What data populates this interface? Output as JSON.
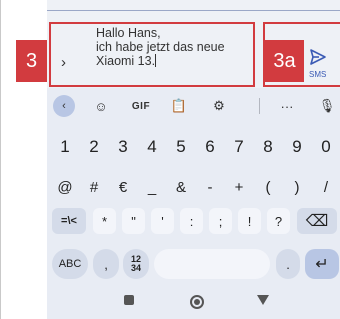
{
  "callouts": {
    "compose": "3",
    "send": "3a"
  },
  "message": {
    "text": "Hallo Hans,\nich habe jetzt das neue\nXiaomi 13.",
    "expand_glyph": "›"
  },
  "send": {
    "label": "SMS",
    "icon": "send-icon",
    "color": "#3b5bb5"
  },
  "toolbar": {
    "back": "‹",
    "emoji": "☺",
    "gif": "GIF",
    "clipboard": "📋",
    "settings": "⚙",
    "more": "···",
    "mic": "🎙"
  },
  "keyboard": {
    "numbers": [
      "1",
      "2",
      "3",
      "4",
      "5",
      "6",
      "7",
      "8",
      "9",
      "0"
    ],
    "symbols": [
      "@",
      "#",
      "€",
      "_",
      "&",
      "-",
      "+",
      "(",
      ")",
      "/"
    ],
    "row3": {
      "switch": "=\\<",
      "keys": [
        "*",
        "\"",
        "'",
        ":",
        ";",
        "!",
        "?"
      ],
      "backspace": "⌫"
    },
    "row4": {
      "abc": "ABC",
      "comma": ",",
      "numpad_top": "12",
      "numpad_bottom": "34",
      "period": ".",
      "enter": "↵"
    }
  },
  "nav": {
    "recents": "recents",
    "home": "home",
    "back": "back"
  },
  "colors": {
    "callout": "#d23b3f",
    "keyboard_bg": "#e8ecf4",
    "compose_bg": "#eef1f6",
    "accent": "#b8c6e4"
  }
}
